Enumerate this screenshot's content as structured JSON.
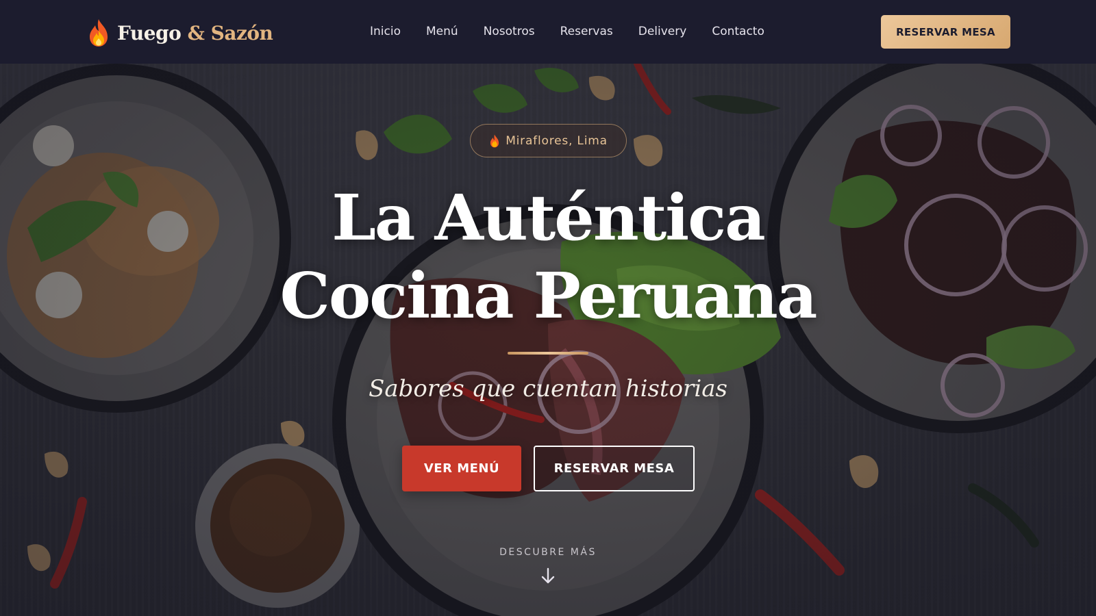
{
  "brand": {
    "name_main": "Fuego",
    "ampersand": "&",
    "name_accent": "Sazón",
    "icon": "fire-icon"
  },
  "nav": {
    "links": [
      "Inicio",
      "Menú",
      "Nosotros",
      "Reservas",
      "Delivery",
      "Contacto"
    ],
    "cta_label": "RESERVAR MESA"
  },
  "hero": {
    "badge_icon": "fire-icon",
    "badge_text": "Miraflores, Lima",
    "title_line1": "La Auténtica",
    "title_line2": "Cocina Peruana",
    "subtitle": "Sabores que cuentan historias",
    "primary_button": "VER MENÚ",
    "secondary_button": "RESERVAR MESA",
    "scroll_label": "DESCUBRE MÁS",
    "scroll_icon": "arrow-down-icon"
  },
  "colors": {
    "nav_background": "#1c1c2e",
    "accent_gold": "#e2b580",
    "primary_red": "#c8392b",
    "text_light": "#ffffff"
  }
}
